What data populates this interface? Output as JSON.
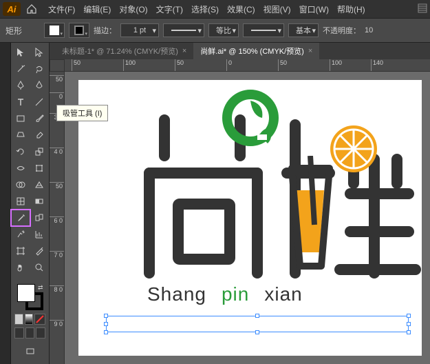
{
  "app": {
    "badge": "Ai"
  },
  "menu": {
    "file": "文件(F)",
    "edit": "编辑(E)",
    "object": "对象(O)",
    "text": "文字(T)",
    "select": "选择(S)",
    "effect": "效果(C)",
    "view": "视图(V)",
    "window": "窗口(W)",
    "help": "帮助(H)"
  },
  "control": {
    "shape": "矩形",
    "stroke_label": "描边：",
    "weight": "1 pt",
    "dash_label": "等比",
    "style_label": "基本",
    "opacity_label": "不透明度：",
    "opacity_value": "10"
  },
  "tabs": {
    "tab0": {
      "label": "未标题-1* @ 71.24% (CMYK/预览)",
      "close": "×"
    },
    "tab1": {
      "label": "尚鲜.ai* @ 150% (CMYK/预览)",
      "close": "×"
    }
  },
  "tooltip": {
    "text": "吸管工具 (I)"
  },
  "rulers": {
    "h": {
      "t0": "50",
      "t1": "100",
      "t2": "50",
      "t3": "0",
      "t4": "50",
      "t5": "100",
      "t6": "140"
    },
    "v": {
      "t0": "50",
      "t1": "0",
      "t2": "3 0",
      "t3": "4 0",
      "t4": "50",
      "t5": "6 0",
      "t6": "7 0",
      "t7": "8 0",
      "t8": "9 0"
    }
  },
  "art": {
    "caption_shang": "Shang",
    "caption_pin": "pin",
    "caption_xian": "xian"
  }
}
